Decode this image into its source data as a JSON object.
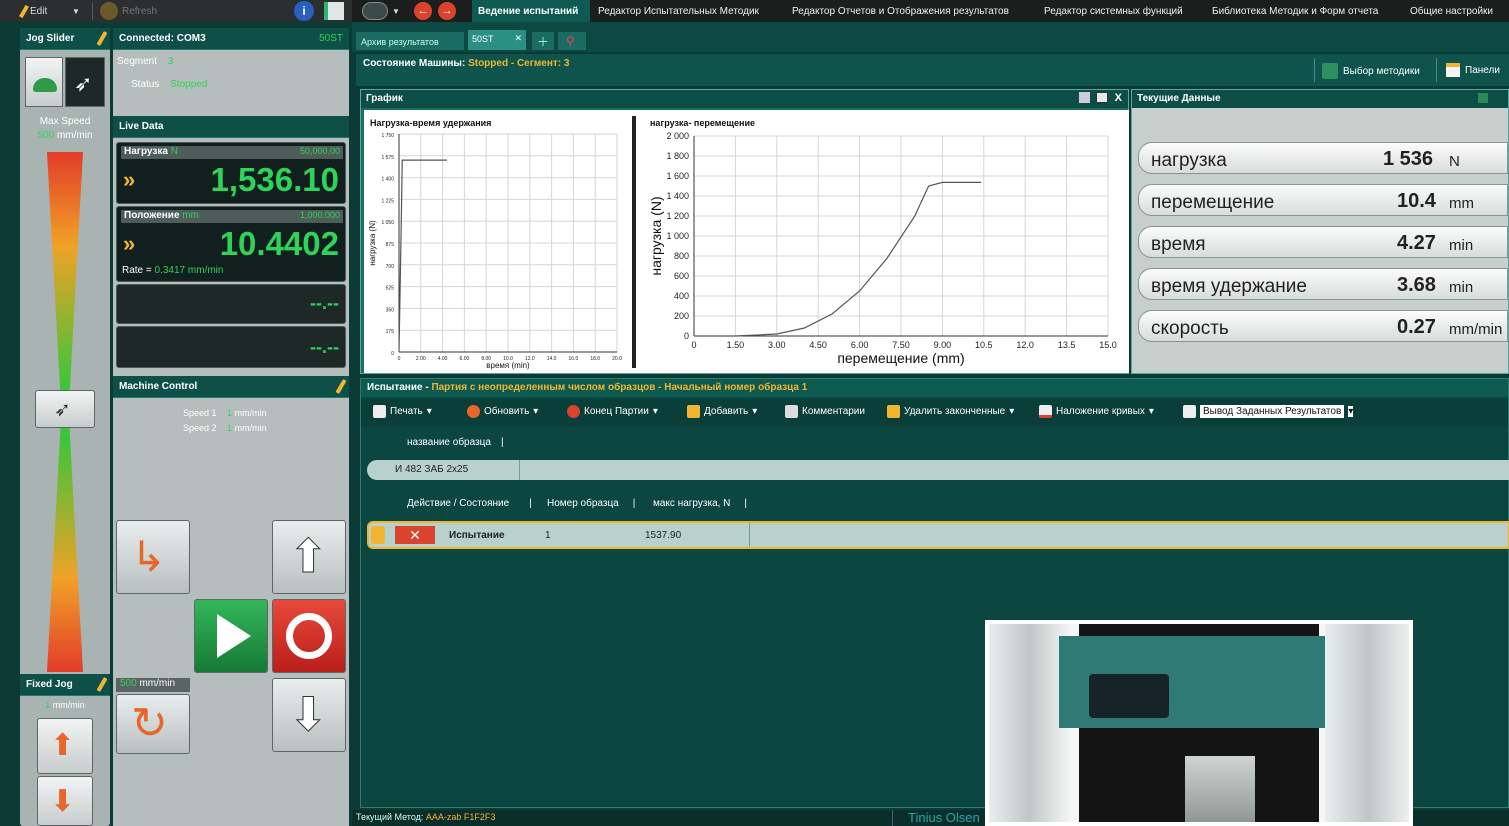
{
  "toolbar": {
    "edit_label": "Edit",
    "refresh_label": "Refresh"
  },
  "menu_tabs": [
    "Ведение испытаний",
    "Редактор Испытательных Методик",
    "Редактор Отчетов и Отображения результатов",
    "Редактор системных функций",
    "Библиотека Методик и Форм отчета",
    "Общие настройки"
  ],
  "jog": {
    "title": "Jog Slider",
    "max_speed_label": "Max Speed",
    "max_speed_value": "500",
    "max_speed_unit": "mm/min",
    "fixed_jog_title": "Fixed Jog",
    "fixed_jog_unit": "mm/min",
    "fixed_jog_value": "1"
  },
  "connection": {
    "title": "Connected: COM3",
    "machine": "50ST",
    "segment_label": "Segment",
    "segment_value": "3",
    "status_label": "Status",
    "status_value": "Stopped"
  },
  "live": {
    "title": "Live Data",
    "load_label": "Нагрузка",
    "load_unit": "N",
    "load_range": "50,000.00",
    "load_value": "1,536.10",
    "pos_label": "Положение",
    "pos_unit": "mm",
    "pos_range": "1,000.000",
    "pos_value": "10.4402",
    "rate_label": "Rate =",
    "rate_value": "0.3417 mm/min",
    "empty1": "--.--",
    "empty2": "--.--"
  },
  "machine_control": {
    "title": "Machine Control",
    "speed1_label": "Speed 1",
    "speed1_value": "1",
    "speed2_label": "Speed 2",
    "speed2_value": "1",
    "speed_unit": "mm/min",
    "return_speed_value": "500",
    "return_speed_unit": "mm/min"
  },
  "doc_tabs": [
    "Архив результатов",
    "50ST"
  ],
  "machine_state": {
    "label": "Состояние Машины:",
    "value": "Stopped - Сегмент: 3",
    "method_select": "Выбор методики",
    "panels": "Панели"
  },
  "graph": {
    "title": "График",
    "close": "X"
  },
  "current_data": {
    "title": "Текущие Данные",
    "rows": [
      {
        "label": "нагрузка",
        "value": "1 536",
        "unit": "N"
      },
      {
        "label": "перемещение",
        "value": "10.4",
        "unit": "mm"
      },
      {
        "label": "время",
        "value": "4.27",
        "unit": "min"
      },
      {
        "label": "время удержание",
        "value": "3.68",
        "unit": "min"
      },
      {
        "label": "скорость",
        "value": "0.27",
        "unit": "mm/min"
      }
    ]
  },
  "test": {
    "header_prefix": "Испытание -",
    "header_text": "Партия с неопределенным числом образцов - Начальный номер образца 1",
    "toolbar": [
      "Печать",
      "Обновить",
      "Конец Партии",
      "Добавить",
      "Комментарии",
      "Удалить законченные",
      "Наложение кривых",
      "Вывод Заданных Результатов"
    ],
    "sample_col": "название образца",
    "sample_name": "И 482 ЗАБ 2х25",
    "columns": [
      "Действие / Состояние",
      "Номер образца",
      "макс нагрузка, N"
    ],
    "row": {
      "action": "Испытание",
      "number": "1",
      "max_load": "1537.90"
    }
  },
  "status_bar": {
    "label": "Текущий Метод:",
    "value": "AAA-zab F1F2F3",
    "brand": "Tinius Olsen"
  },
  "chart_data": [
    {
      "type": "line",
      "title": "Нагрузка-время удержания",
      "xlabel": "время (min)",
      "ylabel": "нагрузка (N)",
      "xlim": [
        0,
        20
      ],
      "ylim": [
        0,
        1750
      ],
      "xticks": [
        "0",
        "2.00",
        "4.00",
        "6.00",
        "8.00",
        "10.0",
        "12.0",
        "14.0",
        "16.0",
        "18.0",
        "20.0"
      ],
      "yticks": [
        "0",
        "175",
        "350",
        "525",
        "700",
        "875",
        "1 050",
        "1 225",
        "1 400",
        "1 575",
        "1 750"
      ],
      "grid": true,
      "series": [
        {
          "x": [
            0,
            0.2,
            0.3,
            4.4
          ],
          "y": [
            0,
            1000,
            1540,
            1540
          ]
        }
      ]
    },
    {
      "type": "line",
      "title": "нагрузка- перемещение",
      "xlabel": "перемещение (mm)",
      "ylabel": "нагрузка (N)",
      "xlim": [
        0,
        15
      ],
      "ylim": [
        0,
        2000
      ],
      "xticks": [
        "0",
        "1.50",
        "3.00",
        "4.50",
        "6.00",
        "7.50",
        "9.00",
        "10.5",
        "12.0",
        "13.5",
        "15.0"
      ],
      "yticks": [
        "0",
        "200",
        "400",
        "600",
        "800",
        "1 000",
        "1 200",
        "1 400",
        "1 600",
        "1 800",
        "2 000"
      ],
      "grid": true,
      "series": [
        {
          "x": [
            0,
            1.5,
            3.0,
            4.0,
            5.0,
            6.0,
            7.0,
            8.0,
            8.5,
            9.0,
            10.4
          ],
          "y": [
            0,
            0,
            20,
            80,
            220,
            450,
            780,
            1200,
            1500,
            1536,
            1536
          ]
        }
      ]
    }
  ]
}
